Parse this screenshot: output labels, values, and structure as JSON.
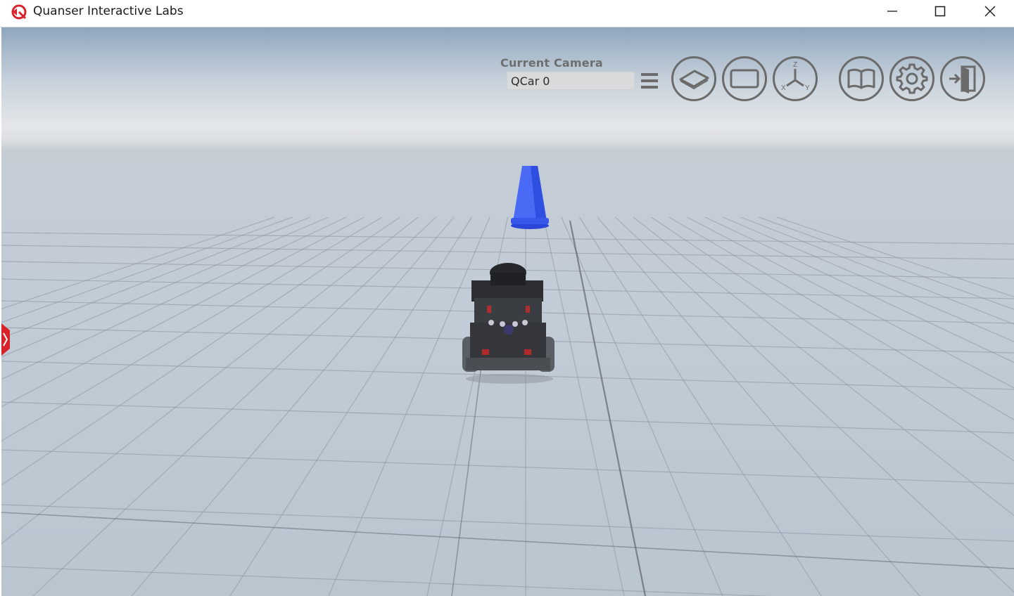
{
  "window": {
    "title": "Quanser Interactive Labs",
    "logo_icon": "quanser-logo-icon",
    "controls": [
      "minimize-icon",
      "maximize-icon",
      "close-icon"
    ]
  },
  "hud": {
    "camera_label": "Current Camera",
    "camera_value": "QCar 0",
    "menu_icon": "hamburger-menu-icon",
    "buttons": [
      {
        "name": "ground-plane-view-button",
        "icon": "plane-icon"
      },
      {
        "name": "fullscreen-view-button",
        "icon": "rectangle-icon"
      },
      {
        "name": "axes-view-button",
        "icon": "xyz-axes-icon",
        "axis_labels": [
          "Z",
          "X",
          "Y"
        ]
      },
      {
        "name": "help-button",
        "icon": "book-icon"
      },
      {
        "name": "settings-button",
        "icon": "gear-icon"
      },
      {
        "name": "exit-button",
        "icon": "exit-door-icon"
      }
    ]
  },
  "scene": {
    "objects": [
      "blue-traffic-cone",
      "qcar-vehicle",
      "grid-floor"
    ],
    "colors": {
      "cone": "#3d5ef0",
      "grid_line": "#8a929a",
      "hud_gray": "#6b6b6b"
    }
  }
}
